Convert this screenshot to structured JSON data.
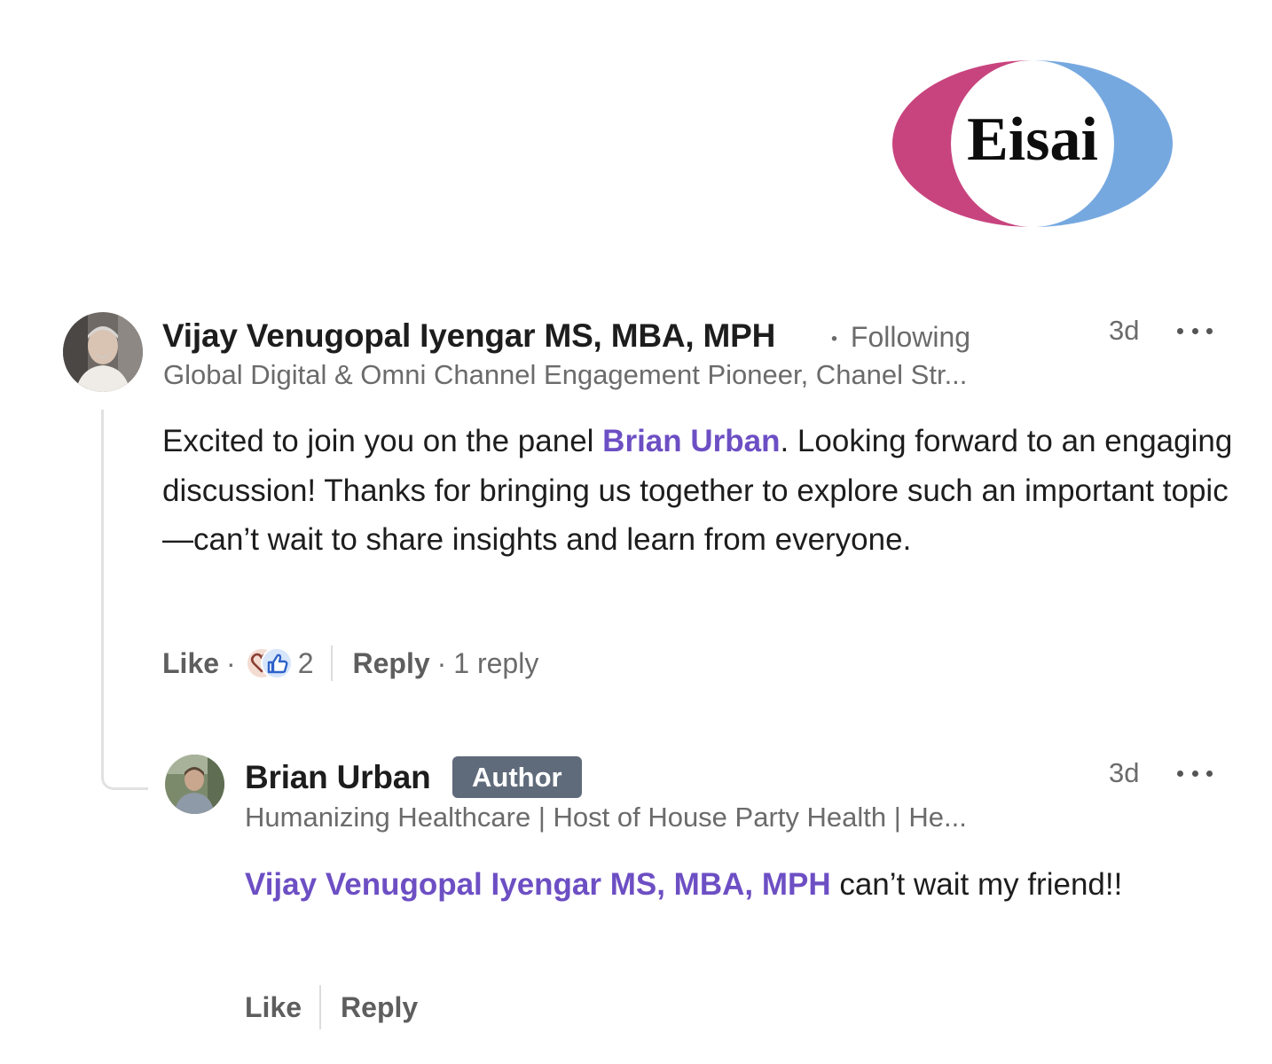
{
  "logo": {
    "text": "Eisai",
    "colors": {
      "left": "#c8447f",
      "right": "#76a8e0"
    }
  },
  "comment": {
    "author": "Vijay Venugopal Iyengar MS, MBA, MPH",
    "separator": "•",
    "following": "Following",
    "headline": "Global Digital & Omni Channel Engagement Pioneer, Chanel Str...",
    "time": "3d",
    "more_icon": "ellipsis-icon",
    "text_before": "Excited to join you on the panel ",
    "mention": "Brian Urban",
    "text_after": ". Looking forward to an engaging discussion! Thanks for bringing us together to explore such an important topic—can’t wait to share insights and learn from everyone.",
    "actions": {
      "like": "Like",
      "dot": "·",
      "reaction_icons": [
        "heart-reaction-icon",
        "thumbs-up-reaction-icon"
      ],
      "reaction_count": "2",
      "reply": "Reply",
      "replies": "1 reply"
    }
  },
  "reply": {
    "author": "Brian Urban",
    "badge": "Author",
    "headline": "Humanizing Healthcare | Host of House Party Health | He...",
    "time": "3d",
    "more_icon": "ellipsis-icon",
    "mention": "Vijay Venugopal Iyengar MS, MBA, MPH",
    "text_after": " can’t wait my friend!!",
    "actions": {
      "like": "Like",
      "reply": "Reply"
    }
  },
  "colors": {
    "mention": "#6d4fc4",
    "badge_bg": "#5f6a7a",
    "muted_text": "#6b6b6b"
  }
}
